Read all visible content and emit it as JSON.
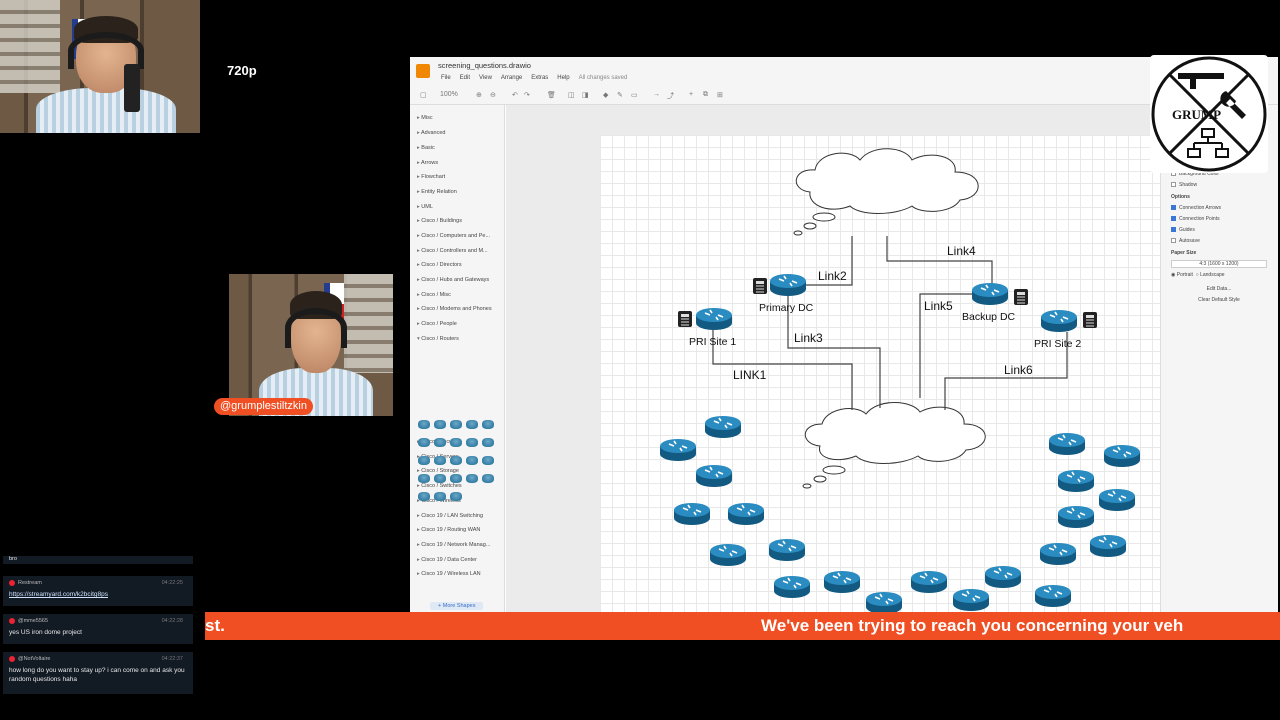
{
  "stream": {
    "quality_label": "720p",
    "host_tag": "@grumplestiltzkin",
    "ticker_left": "st.",
    "ticker_right": "We've been trying to reach you concerning your veh"
  },
  "chat": {
    "messages": [
      {
        "author": "",
        "time": "",
        "text": "bro"
      },
      {
        "author": "Restream",
        "time": "04:22:25",
        "text": "https://streamyard.com/k2bcitg8ps",
        "is_link": true
      },
      {
        "author": "@mme5565",
        "time": "04:22:28",
        "text": "yes US iron dome project"
      },
      {
        "author": "@NotVoltaire",
        "time": "04:22:37",
        "text": "how long do you want to stay up? i can come on and ask you random questions haha"
      }
    ]
  },
  "app": {
    "file_title": "screening_questions.drawio",
    "menus": [
      "File",
      "Edit",
      "View",
      "Arrange",
      "Extras",
      "Help"
    ],
    "save_status": "All changes saved",
    "zoom": "100%",
    "accent": "#f08705"
  },
  "sidebar": {
    "items": [
      "Misc",
      "Advanced",
      "Basic",
      "Arrows",
      "Flowchart",
      "Entity Relation",
      "UML",
      "Cisco / Buildings",
      "Cisco / Computers and Pe...",
      "Cisco / Controllers and M...",
      "Cisco / Directors",
      "Cisco / Hubs and Gateways",
      "Cisco / Misc",
      "Cisco / Modems and Phones",
      "Cisco / People",
      "Cisco / Routers"
    ],
    "items_after": [
      "Cisco / Security",
      "Cisco / Servers",
      "Cisco / Storage",
      "Cisco / Switches",
      "Cisco / Wireless",
      "Cisco 19 / LAN Switching",
      "Cisco 19 / Routing WAN",
      "Cisco 19 / Network Manag...",
      "Cisco 19 / Data Center",
      "Cisco 19 / Wireless LAN"
    ],
    "more_shapes": "+ More Shapes"
  },
  "format_panel": {
    "lines": [
      "Background Color",
      "Shadow"
    ],
    "options_heading": "Options",
    "options": [
      {
        "label": "Connection Arrows",
        "checked": true
      },
      {
        "label": "Connection Points",
        "checked": true
      },
      {
        "label": "Guides",
        "checked": true
      },
      {
        "label": "Autosave",
        "checked": false
      }
    ],
    "paper_heading": "Paper Size",
    "paper_value": "4:3 (1600 x 1200)",
    "portrait": "Portrait",
    "landscape": "Landscape",
    "edit_data": "Edit Data...",
    "clear_style": "Clear Default Style"
  },
  "diagram": {
    "labels": {
      "primary_dc": "Primary DC",
      "backup_dc": "Backup DC",
      "site1": "PRI Site 1",
      "site2": "PRI Site 2",
      "link1": "LINK1",
      "link2": "Link2",
      "link3": "Link3",
      "link4": "Link4",
      "link5": "Link5",
      "link6": "Link6"
    },
    "router_color": "#1e7fb0"
  },
  "logo": {
    "text": "GRUMP"
  }
}
